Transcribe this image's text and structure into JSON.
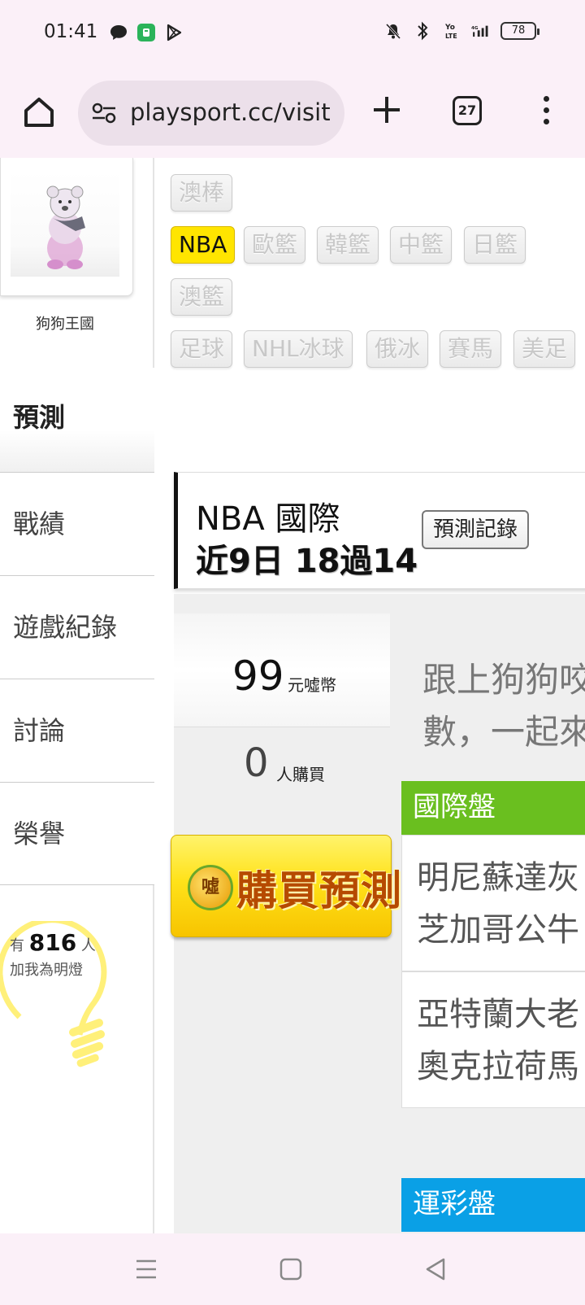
{
  "status_bar": {
    "time": "01:41",
    "battery": "78",
    "icons_left": [
      "chat-bubble-icon",
      "green-app-icon",
      "play-store-icon"
    ],
    "icons_right": [
      "mute-bell-icon",
      "bluetooth-icon",
      "volte-icon",
      "signal-4g-icon",
      "battery-icon"
    ]
  },
  "browser": {
    "url": "playsport.cc/visit",
    "tab_count": "27"
  },
  "profile": {
    "name": "狗狗王國"
  },
  "sidebar": {
    "active": "預測",
    "items": [
      "戰績",
      "遊戲紀錄",
      "討論",
      "榮譽"
    ]
  },
  "fans": {
    "prefix": "有",
    "count": "816",
    "suffix": "人",
    "line2": "加我為明燈"
  },
  "sports_tags": {
    "row0": [
      "澳棒"
    ],
    "row1": [
      "NBA",
      "歐籃",
      "韓籃",
      "中籃",
      "日籃"
    ],
    "row2": [
      "澳籃"
    ],
    "row3": [
      "足球",
      "NHL冰球",
      "俄冰",
      "賽馬",
      "美足"
    ],
    "active": "NBA"
  },
  "prediction": {
    "league": "NBA 國際",
    "record": "近9日 18過14",
    "record_button": "預測記錄",
    "price": "99",
    "price_unit": "元噓幣",
    "buyers": "0",
    "buyers_unit": "人購買",
    "buy_button": "購買預測",
    "coin_label": "噓",
    "promo_lines": [
      "跟上狗狗咬",
      "數，一起來"
    ]
  },
  "markets": {
    "international": "國際盤",
    "lottery": "運彩盤",
    "matches": [
      {
        "home": "明尼蘇達灰",
        "away": "芝加哥公牛"
      },
      {
        "home": "亞特蘭大老",
        "away": "奧克拉荷馬"
      }
    ]
  },
  "colors": {
    "active_tag": "#ffe500",
    "international_header": "#6abf1f",
    "lottery_header": "#0aa0e6",
    "chrome_bg": "#fbf0f8"
  }
}
